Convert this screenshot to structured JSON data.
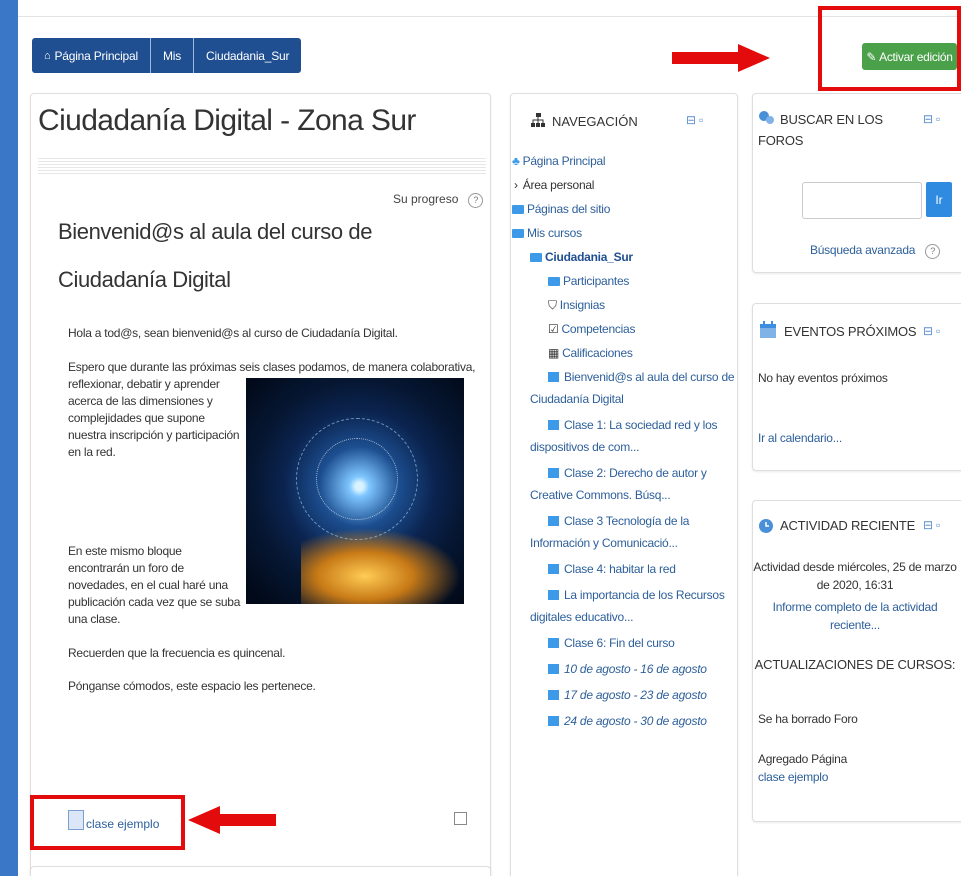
{
  "breadcrumb": {
    "home": "Página Principal",
    "mis": "Mis",
    "course": "Ciudadania_Sur"
  },
  "edit_button": "Activar edición",
  "course": {
    "title": "Ciudadanía Digital - Zona Sur",
    "progress_label": "Su progreso",
    "welcome_line1": "Bienvenid@s al aula del curso de",
    "welcome_line2": "Ciudadanía Digital",
    "para1": "Hola a tod@s, sean bienvenid@s al curso de Ciudadanía Digital.",
    "para2": [
      "Espero que durante las próximas seis clases podamos, de manera colaborativa,",
      "reflexionar, debatir y aprender",
      "acerca de las dimensiones y",
      "complejidades que supone",
      "nuestra inscripción y participación",
      "en la red."
    ],
    "para3": [
      "En este mismo bloque",
      "encontrarán un foro de",
      "novedades, en el cual haré una",
      "publicación cada vez que se suba",
      "una clase."
    ],
    "para4": "Recuerden que la frecuencia es quincenal.",
    "para5": "Pónganse cómodos, este espacio les pertenece.",
    "activity_link": "clase ejemplo"
  },
  "navigation": {
    "title": "NAVEGACIÓN",
    "home": "Página Principal",
    "area": "Área personal",
    "site_pages": "Páginas del sitio",
    "my_courses": "Mis cursos",
    "course": "Ciudadania_Sur",
    "participants": "Participantes",
    "badges": "Insignias",
    "competencies": "Competencias",
    "grades": "Calificaciones",
    "items": [
      [
        "Bienvenid@s al aula del curso de",
        "Ciudadanía Digital"
      ],
      [
        "Clase 1: La sociedad red y los",
        "dispositivos de com..."
      ],
      [
        "Clase 2: Derecho de autor y",
        "Creative Commons. Búsq..."
      ],
      [
        "Clase 3 Tecnología de la",
        "Información y Comunicació..."
      ],
      [
        "Clase 4: habitar la red"
      ],
      [
        "La importancia de los Recursos",
        "digitales educativo..."
      ],
      [
        "Clase 6: Fin del curso"
      ]
    ],
    "weeks": [
      "10 de agosto - 16 de agosto",
      "17 de agosto - 23 de agosto",
      "24 de agosto - 30 de agosto"
    ]
  },
  "search_forums": {
    "title_line1": "BUSCAR EN LOS",
    "title_line2": "FOROS",
    "button": "Ir",
    "advanced": "Búsqueda avanzada"
  },
  "events": {
    "title": "EVENTOS PRÓXIMOS",
    "none": "No hay eventos próximos",
    "calendar": "Ir al calendario..."
  },
  "recent": {
    "title": "ACTIVIDAD RECIENTE",
    "since_line1": "Actividad desde miércoles, 25 de marzo",
    "since_line2": "de 2020, 16:31",
    "report_line1": "Informe completo de la actividad",
    "report_line2": "reciente...",
    "updates_title": "ACTUALIZACIONES DE CURSOS:",
    "deleted": "Se ha borrado Foro",
    "added": "Agregado Página",
    "added_link": "clase ejemplo"
  },
  "colors": {
    "breadcrumb": "#1f4f91",
    "edit": "#4aa14a",
    "highlight": "#e30b0b",
    "link": "#2d5f9a",
    "frame": "#3a78c7"
  }
}
